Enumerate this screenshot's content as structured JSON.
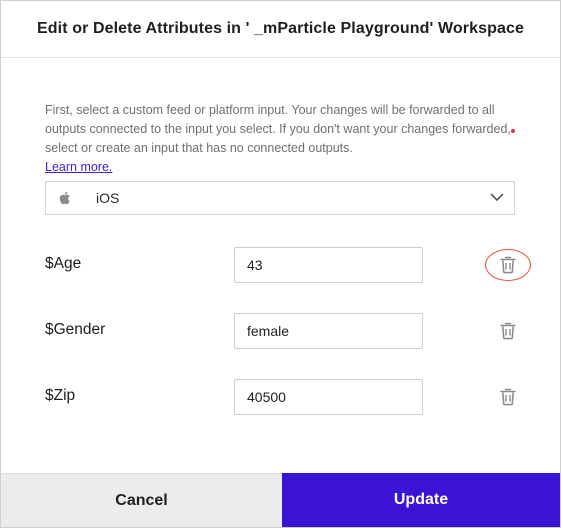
{
  "dialog": {
    "title": "Edit or Delete Attributes in ' _mParticle Playground' Workspace",
    "description": "First, select a custom feed or platform input. Your changes will be forwarded to all outputs connected to the input you select. If you don't want your changes forwarded, select or create an input that has no connected outputs.",
    "learn_more": "Learn more."
  },
  "input_select": {
    "icon": "apple-icon",
    "selected_value": "iOS"
  },
  "attributes": [
    {
      "name": "$Age",
      "value": "43",
      "delete_highlighted": true
    },
    {
      "name": "$Gender",
      "value": "female",
      "delete_highlighted": false
    },
    {
      "name": "$Zip",
      "value": "40500",
      "delete_highlighted": false
    }
  ],
  "footer": {
    "cancel_label": "Cancel",
    "update_label": "Update"
  },
  "colors": {
    "primary": "#3a13d4",
    "link": "#3b1fd6",
    "highlight_ring": "#e5533a"
  }
}
